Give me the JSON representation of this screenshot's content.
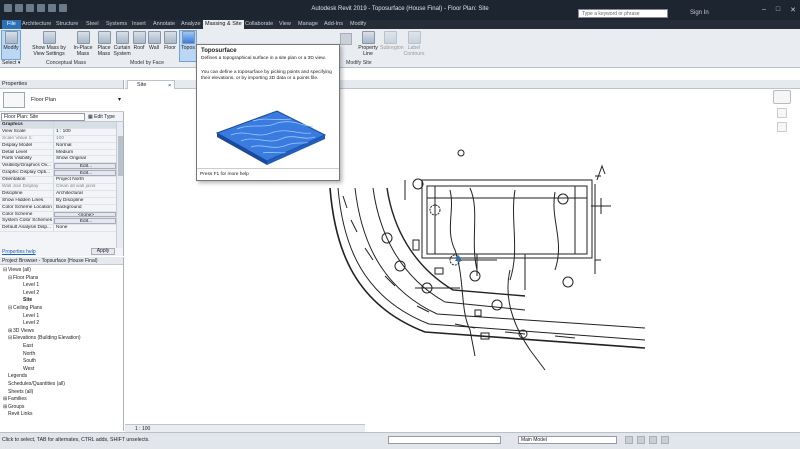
{
  "app": {
    "title": "Autodesk Revit 2019 - Toposurface (House Final) - Floor Plan: Site",
    "search_placeholder": "Type a keyword or phrase",
    "sign_in": "Sign In"
  },
  "ribbon_tabs": [
    "File",
    "Architecture",
    "Structure",
    "Steel",
    "Systems",
    "Insert",
    "Annotate",
    "Analyze",
    "Massing & Site",
    "Collaborate",
    "View",
    "Manage",
    "Add-Ins",
    "Modify"
  ],
  "ribbon": {
    "modify": "Modify",
    "select": "Select ▾",
    "show_mass": "Show Mass by View Settings",
    "inplace_mass": "In-Place Mass",
    "place_mass": "Place Mass",
    "curtain_system": "Curtain System",
    "roof": "Roof",
    "wall": "Wall",
    "floor": "Floor",
    "topo": "Topos",
    "graded_region": "Graded Region",
    "property_line": "Property Line",
    "subregion": "Subregion",
    "label_contours": "Label Contours",
    "panel_conceptual": "Conceptual Mass",
    "panel_model_by_face": "Model by Face",
    "panel_modify_site": "Modify Site"
  },
  "tooltip": {
    "title": "Toposurface",
    "body1": "Defines a topographical surface in a site plan or a 3D view.",
    "body2": "You can define a toposurface by picking points and specifying their elevations, or by importing 3D data or a points file.",
    "footer": "Press F1 for more help"
  },
  "properties": {
    "header": "Properties",
    "type_name": "Floor Plan",
    "instance": "Floor Plan: Site",
    "edit_type": "Edit Type",
    "help_link": "Properties help",
    "apply": "Apply",
    "rows": [
      {
        "k": "Graphics",
        "v": "",
        "group": true
      },
      {
        "k": "View Scale",
        "v": "1 : 100",
        "btn": false
      },
      {
        "k": "Scale Value  1:",
        "v": "100",
        "dim": true
      },
      {
        "k": "Display Model",
        "v": "Normal"
      },
      {
        "k": "Detail Level",
        "v": "Medium"
      },
      {
        "k": "Parts Visibility",
        "v": "Show Original"
      },
      {
        "k": "Visibility/Graphics Ov...",
        "v": "Edit...",
        "btn": true
      },
      {
        "k": "Graphic Display Opti...",
        "v": "Edit...",
        "btn": true
      },
      {
        "k": "Orientation",
        "v": "Project North"
      },
      {
        "k": "Wall Join Display",
        "v": "Clean all wall joins",
        "dim": true
      },
      {
        "k": "Discipline",
        "v": "Architectural"
      },
      {
        "k": "Show Hidden Lines",
        "v": "By Discipline"
      },
      {
        "k": "Color Scheme Location",
        "v": "Background"
      },
      {
        "k": "Color Scheme",
        "v": "<none>",
        "btn": true
      },
      {
        "k": "System Color Schemes",
        "v": "Edit...",
        "btn": true
      },
      {
        "k": "Default Analysis Disp...",
        "v": "None"
      }
    ]
  },
  "browser": {
    "header": "Project Browser - Topsurface (House Final)",
    "nodes": [
      {
        "t": "Views (all)",
        "lvl": 0,
        "exp": "⊟"
      },
      {
        "t": "Floor Plans",
        "lvl": 1,
        "exp": "⊟"
      },
      {
        "t": "Level 1",
        "lvl": 3,
        "exp": ""
      },
      {
        "t": "Level 2",
        "lvl": 3,
        "exp": ""
      },
      {
        "t": "Site",
        "lvl": 3,
        "exp": "",
        "bold": true
      },
      {
        "t": "Ceiling Plans",
        "lvl": 1,
        "exp": "⊟"
      },
      {
        "t": "Level 1",
        "lvl": 3,
        "exp": ""
      },
      {
        "t": "Level 2",
        "lvl": 3,
        "exp": ""
      },
      {
        "t": "3D Views",
        "lvl": 1,
        "exp": "⊞"
      },
      {
        "t": "Elevations (Building Elevation)",
        "lvl": 1,
        "exp": "⊟"
      },
      {
        "t": "East",
        "lvl": 3,
        "exp": ""
      },
      {
        "t": "North",
        "lvl": 3,
        "exp": ""
      },
      {
        "t": "South",
        "lvl": 3,
        "exp": ""
      },
      {
        "t": "West",
        "lvl": 3,
        "exp": ""
      },
      {
        "t": "Legends",
        "lvl": 0,
        "exp": ""
      },
      {
        "t": "Schedules/Quantities (all)",
        "lvl": 0,
        "exp": ""
      },
      {
        "t": "Sheets (all)",
        "lvl": 0,
        "exp": ""
      },
      {
        "t": "Families",
        "lvl": 0,
        "exp": "⊞"
      },
      {
        "t": "Groups",
        "lvl": 0,
        "exp": "⊞"
      },
      {
        "t": "Revit Links",
        "lvl": 0,
        "exp": ""
      }
    ]
  },
  "view": {
    "tab": "Site",
    "scale": "1 : 100"
  },
  "status": {
    "text": "Click to select, TAB for alternates, CTRL adds, SHIFT unselects.",
    "model": "Main Model"
  },
  "colors": {
    "titlebar": "#1d2530",
    "accent": "#2d6fb3",
    "topo": "#3a7be0"
  }
}
